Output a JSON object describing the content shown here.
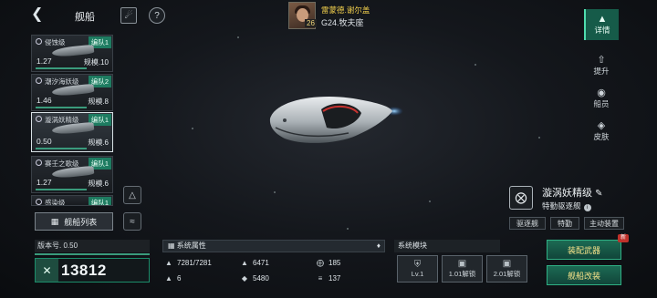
{
  "header": {
    "back_icon": "back-chevron-icon",
    "title": "舰船",
    "filter_icon": "filter-icon",
    "help_icon": "help-icon",
    "help_glyph": "?"
  },
  "commander": {
    "name": "雷蒙德.谢尔盖",
    "location": "G24.牧夫座",
    "level": "26"
  },
  "ship_list": [
    {
      "name": "侵蚀级",
      "fleet": "编队1",
      "version": "1.27",
      "scale": "规模.10"
    },
    {
      "name": "潮汐海妖级",
      "fleet": "编队2",
      "version": "1.46",
      "scale": "规模.8"
    },
    {
      "name": "漩涡妖精级",
      "fleet": "编队1",
      "version": "0.50",
      "scale": "规模.6"
    },
    {
      "name": "赛壬之歌级",
      "fleet": "编队1",
      "version": "1.27",
      "scale": "规模.6"
    },
    {
      "name": "感染级",
      "fleet": "编队1",
      "version": "",
      "scale": ""
    }
  ],
  "ship_list_button": "舰船列表",
  "nav": [
    {
      "label": "详情",
      "icon": "details-icon",
      "active": true
    },
    {
      "label": "提升",
      "icon": "upgrade-icon",
      "active": false
    },
    {
      "label": "船员",
      "icon": "crew-icon",
      "active": false
    },
    {
      "label": "皮肤",
      "icon": "skin-icon",
      "active": false
    }
  ],
  "ship_info": {
    "name": "漩涡妖精级",
    "type": "特勤驱逐舰",
    "tags": [
      "驱逐舰",
      "特勤",
      "主动装置"
    ]
  },
  "bottom": {
    "version_label": "版本号. 0.50",
    "power": "13812",
    "attr_title": "系统属性",
    "attributes": [
      {
        "icon": "hull-icon",
        "value": "7281/7281"
      },
      {
        "icon": "firepower-icon",
        "value": "6471"
      },
      {
        "icon": "armor-icon",
        "value": "185"
      },
      {
        "icon": "slot-icon",
        "value": "6"
      },
      {
        "icon": "energy-icon",
        "value": "5480"
      },
      {
        "icon": "speed-icon",
        "value": "137"
      }
    ],
    "module_title": "系统模块",
    "modules": [
      {
        "label": "Lv.1",
        "locked": false
      },
      {
        "label": "1.01解锁",
        "locked": true
      },
      {
        "label": "2.01解锁",
        "locked": true
      }
    ],
    "equip_button": "装配武器",
    "refit_button": "舰船改装",
    "new_badge": "新"
  },
  "colors": {
    "accent": "#1e7c61",
    "highlight": "#4fdcae",
    "gold": "#f1cf4c",
    "badge": "#c0322b"
  }
}
